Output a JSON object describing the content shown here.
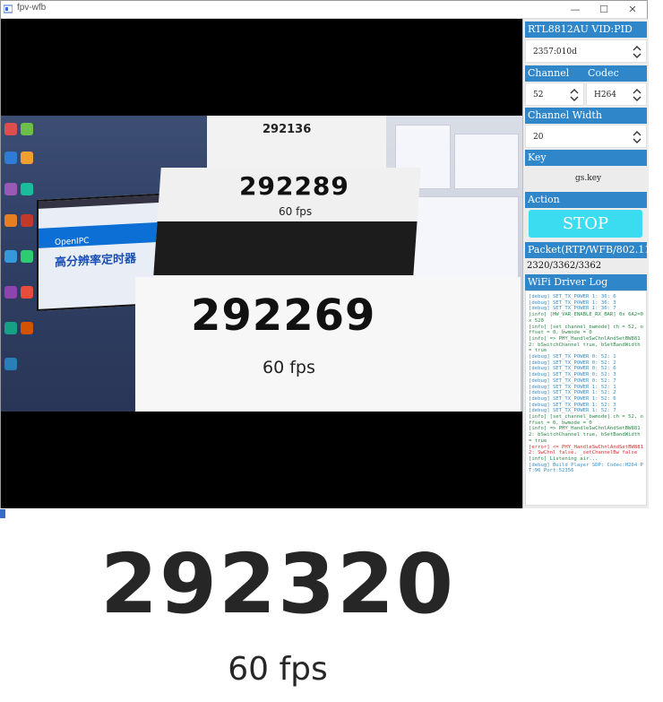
{
  "window": {
    "title": "fpv-wfb",
    "controls": {
      "minimize": "—",
      "maximize": "☐",
      "close": "✕"
    }
  },
  "video_overlay": {
    "top_number": "292136",
    "card_number": "292289",
    "card_fps": "60 fps",
    "main_number": "292269",
    "main_fps": "60 fps",
    "left_monitor_brand": "OpenIPC",
    "left_monitor_heading": "高分辨率定时器"
  },
  "panel": {
    "adapter_header": "RTL8812AU VID:PID",
    "adapter_value": "2357:010d",
    "channel_header": "Channel",
    "codec_header": "Codec",
    "channel_value": "52",
    "codec_value": "H264",
    "width_header": "Channel Width",
    "width_value": "20",
    "key_header": "Key",
    "key_value": "gs.key",
    "action_header": "Action",
    "stop_label": "STOP",
    "packet_header": "Packet(RTP/WFB/802.11)",
    "packet_value": "2320/3362/3362",
    "log_header": "WiFi Driver Log",
    "log": [
      {
        "level": "debug",
        "text": "[debug] SET_TX_POWER 1: 36: 6"
      },
      {
        "level": "debug",
        "text": "[debug] SET_TX_POWER 1: 36: 3"
      },
      {
        "level": "debug",
        "text": "[debug] SET_TX_POWER 1: 36: 7"
      },
      {
        "level": "info",
        "text": "[info] [HW_VAR_ENABLE_RX_BAR] 0x 6A2=0x 520"
      },
      {
        "level": "info",
        "text": "[info] [set_channel_bwmode] ch = 52, offset = 0, bwmode = 0"
      },
      {
        "level": "info",
        "text": "[info] => PHY_HandleSwChnlAndSetBW8812: bSwitchChannel true, bSetBandWidth = true"
      },
      {
        "level": "debug",
        "text": "[debug] SET_TX_POWER 0: 52: 1"
      },
      {
        "level": "debug",
        "text": "[debug] SET_TX_POWER 0: 52: 2"
      },
      {
        "level": "debug",
        "text": "[debug] SET_TX_POWER 0: 52: 6"
      },
      {
        "level": "debug",
        "text": "[debug] SET_TX_POWER 0: 52: 3"
      },
      {
        "level": "debug",
        "text": "[debug] SET_TX_POWER 0: 52: 7"
      },
      {
        "level": "debug",
        "text": "[debug] SET_TX_POWER 1: 52: 1"
      },
      {
        "level": "debug",
        "text": "[debug] SET_TX_POWER 1: 52: 2"
      },
      {
        "level": "debug",
        "text": "[debug] SET_TX_POWER 1: 52: 6"
      },
      {
        "level": "debug",
        "text": "[debug] SET_TX_POWER 1: 52: 3"
      },
      {
        "level": "debug",
        "text": "[debug] SET_TX_POWER 1: 52: 7"
      },
      {
        "level": "info",
        "text": "[info] [set_channel_bwmode] ch = 52, offset = 0, bwmode = 0"
      },
      {
        "level": "info",
        "text": "[info] => PHY_HandleSwChnlAndSetBW8812: bSwitchChannel true, bSetBandWidth = true"
      },
      {
        "level": "error",
        "text": "[error] <= PHY_HandleSwChnlAndSetBW8812: SwChnl false, _setChannelBw false"
      },
      {
        "level": "info",
        "text": "[info] Listening air..."
      },
      {
        "level": "debug",
        "text": "[debug] Build Player SDP: Codec:H264 PT:96 Port:52356"
      }
    ]
  },
  "below": {
    "counter": "292320",
    "fps": "60 fps"
  },
  "colors": {
    "section_header": "#2f86c9",
    "stop_button": "#3cdcf0",
    "log_debug": "#3a8fc4",
    "log_info": "#2a8a4a",
    "log_error": "#d23030"
  }
}
